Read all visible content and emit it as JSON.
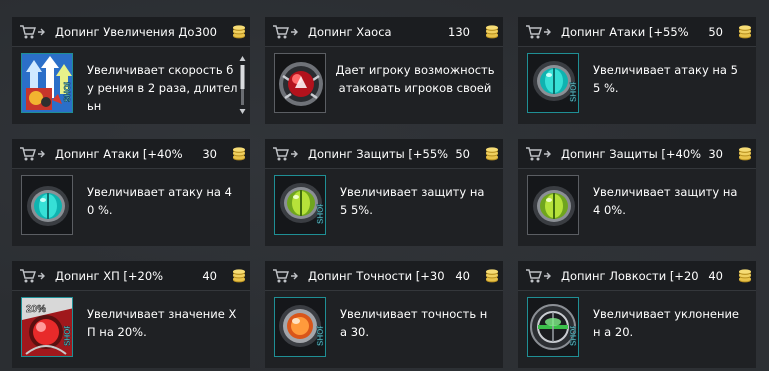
{
  "colors": {
    "accent": "#1f8f95",
    "coin": "#e8c24a",
    "header_bg": "#1b1d20",
    "body_bg": "#1f2124"
  },
  "items": [
    {
      "name": "Допинг Увеличения До..",
      "price": "300",
      "description": "Увеличивает скорость бу рения в 2 раза, длительн",
      "icon": "drill-speed-boost-icon",
      "shop_badge": "SHOP"
    },
    {
      "name": "Допинг Хаоса",
      "price": "130",
      "description": "Дает игроку возможность атаковать игроков своей",
      "icon": "chaos-orb-icon",
      "shop_badge": ""
    },
    {
      "name": "Допинг Атаки [+55%",
      "price": "50",
      "description": "Увеличивает атаку на 55 %.",
      "icon": "cyan-attack-orb-icon",
      "shop_badge": "SHOP"
    },
    {
      "name": "Допинг Атаки [+40%",
      "price": "30",
      "description": "Увеличивает атаку на 40 %.",
      "icon": "cyan-attack-orb-icon",
      "shop_badge": ""
    },
    {
      "name": "Допинг Защиты [+55%",
      "price": "50",
      "description": "Увеличивает защиту на 5 5%.",
      "icon": "green-defense-orb-icon",
      "shop_badge": "SHOP"
    },
    {
      "name": "Допинг Защиты [+40%",
      "price": "30",
      "description": "Увеличивает защиту на 4 0%.",
      "icon": "green-defense-orb-icon",
      "shop_badge": ""
    },
    {
      "name": "Допинг ХП [+20%",
      "price": "40",
      "description": "Увеличивает значение Х П на 20%.",
      "icon": "red-hp-orb-icon",
      "shop_badge": "SHOP",
      "icon_text": "20%"
    },
    {
      "name": "Допинг Точности [+30",
      "price": "40",
      "description": "Увеличивает точность на 30.",
      "icon": "orange-accuracy-orb-icon",
      "shop_badge": "SHOP"
    },
    {
      "name": "Допинг Ловкости [+20",
      "price": "40",
      "description": "Увеличивает уклонение н а 20.",
      "icon": "green-agility-orb-icon",
      "shop_badge": "SHOP"
    }
  ]
}
